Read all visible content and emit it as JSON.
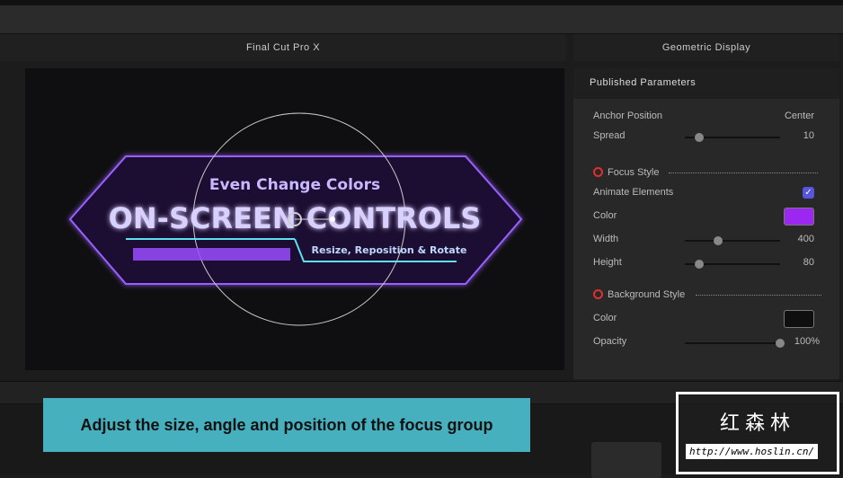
{
  "header": {
    "viewer_title": "Final Cut Pro X",
    "panel_title": "Geometric Display"
  },
  "viewer": {
    "line1": "Even Change Colors",
    "line2": "ON-SCREEN CONTROLS",
    "line3": "Resize, Reposition & Rotate"
  },
  "panel": {
    "title": "Published Parameters",
    "anchor": {
      "label": "Anchor Position",
      "value": "Center"
    },
    "spread": {
      "label": "Spread",
      "value": "10",
      "fraction": 0.05
    },
    "focus_style": {
      "label": "Focus Style",
      "animate": {
        "label": "Animate Elements",
        "checked": true
      },
      "color": {
        "label": "Color",
        "value": "#9b27f0"
      },
      "width": {
        "label": "Width",
        "value": "400",
        "fraction": 0.35
      },
      "height": {
        "label": "Height",
        "value": "80",
        "fraction": 0.15
      }
    },
    "background_style": {
      "label": "Background Style",
      "color": {
        "label": "Color",
        "value": "#0f0f0f"
      },
      "opacity": {
        "label": "Opacity",
        "value": "100%",
        "fraction": 1.0
      }
    }
  },
  "caption": "Adjust the size, angle and position of the focus group",
  "watermark": {
    "name": "红森林",
    "url": "http://www.hoslin.cn/"
  }
}
